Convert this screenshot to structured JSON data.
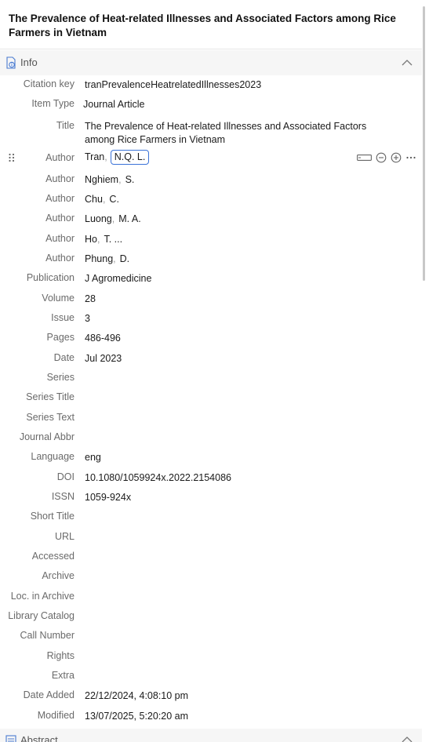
{
  "item_title": "The Prevalence of Heat-related Illnesses and Associated Factors among Rice Farmers in Vietnam",
  "info_section": {
    "label": "Info"
  },
  "abstract_section": {
    "label": "Abstract"
  },
  "fields": {
    "citation_key": {
      "label": "Citation key",
      "value": "tranPrevalenceHeatrelatedIllnesses2023"
    },
    "item_type": {
      "label": "Item Type",
      "value": "Journal Article"
    },
    "title": {
      "label": "Title",
      "value": "The Prevalence of Heat-related Illnesses and Associated Factors among Rice Farmers in Vietnam"
    },
    "publication": {
      "label": "Publication",
      "value": "J Agromedicine"
    },
    "volume": {
      "label": "Volume",
      "value": "28"
    },
    "issue": {
      "label": "Issue",
      "value": "3"
    },
    "pages": {
      "label": "Pages",
      "value": "486-496"
    },
    "date": {
      "label": "Date",
      "value": "Jul 2023"
    },
    "series": {
      "label": "Series",
      "value": ""
    },
    "series_title": {
      "label": "Series Title",
      "value": ""
    },
    "series_text": {
      "label": "Series Text",
      "value": ""
    },
    "journal_abbr": {
      "label": "Journal Abbr",
      "value": ""
    },
    "language": {
      "label": "Language",
      "value": "eng"
    },
    "doi": {
      "label": "DOI",
      "value": "10.1080/1059924x.2022.2154086"
    },
    "issn": {
      "label": "ISSN",
      "value": "1059-924x"
    },
    "short_title": {
      "label": "Short Title",
      "value": ""
    },
    "url": {
      "label": "URL",
      "value": ""
    },
    "accessed": {
      "label": "Accessed",
      "value": ""
    },
    "archive": {
      "label": "Archive",
      "value": ""
    },
    "loc_in_archive": {
      "label": "Loc. in Archive",
      "value": ""
    },
    "library_catalog": {
      "label": "Library Catalog",
      "value": ""
    },
    "call_number": {
      "label": "Call Number",
      "value": ""
    },
    "rights": {
      "label": "Rights",
      "value": ""
    },
    "extra": {
      "label": "Extra",
      "value": ""
    },
    "date_added": {
      "label": "Date Added",
      "value": "22/12/2024, 4:08:10 pm"
    },
    "modified": {
      "label": "Modified",
      "value": "13/07/2025, 5:20:20 am"
    }
  },
  "authors": [
    {
      "label": "Author",
      "last": "Tran",
      "first": "N.Q. L."
    },
    {
      "label": "Author",
      "last": "Nghiem",
      "first": "S."
    },
    {
      "label": "Author",
      "last": "Chu",
      "first": "C."
    },
    {
      "label": "Author",
      "last": "Luong",
      "first": "M. A."
    },
    {
      "label": "Author",
      "last": "Ho",
      "first": "T. ..."
    },
    {
      "label": "Author",
      "last": "Phung",
      "first": "D."
    }
  ],
  "author_separator": ",",
  "colors": {
    "accent": "#3b73d8",
    "label_gray": "#6a6a6a",
    "header_bg": "#f6f6f6"
  },
  "icons": [
    "document-info-icon",
    "chevron-up-icon",
    "drag-handle-icon",
    "switch-field-mode-icon",
    "remove-author-icon",
    "add-author-icon",
    "more-options-icon",
    "abstract-icon"
  ]
}
